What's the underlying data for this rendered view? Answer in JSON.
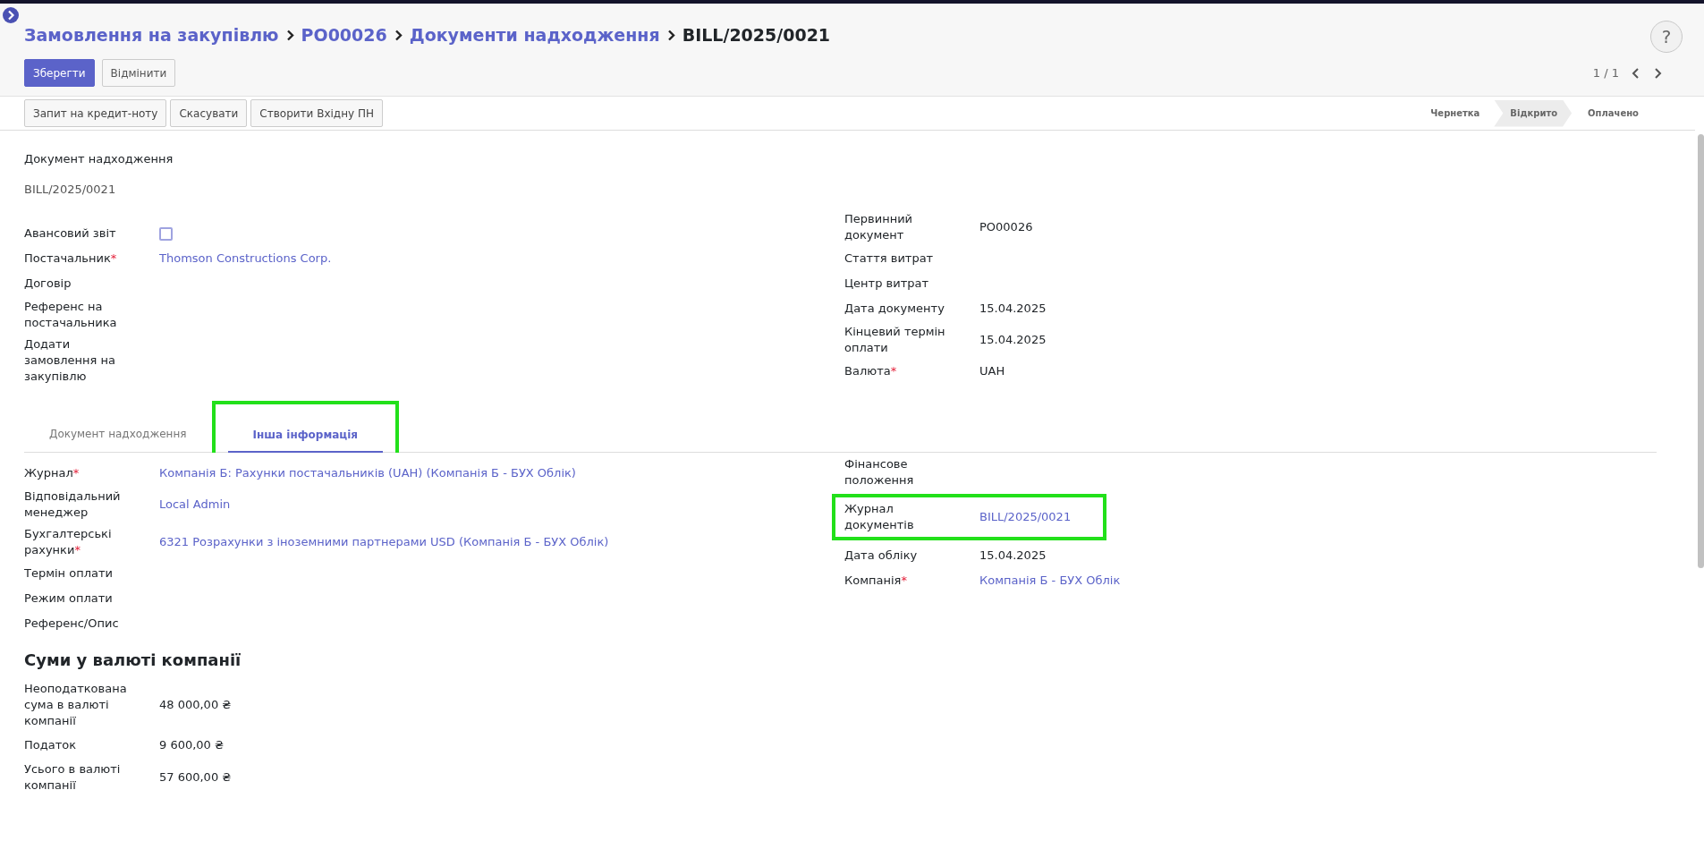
{
  "breadcrumb": [
    {
      "text": "Замовлення на закупівлю",
      "link": true
    },
    {
      "text": "PO00026",
      "link": true
    },
    {
      "text": "Документи надходження",
      "link": true
    },
    {
      "text": "BILL/2025/0021",
      "link": false
    }
  ],
  "buttons": [
    {
      "label": "Зберегти",
      "kind": "primary"
    },
    {
      "label": "Відмінити",
      "kind": "secondary"
    }
  ],
  "help_button": "?",
  "pager": "1 / 1",
  "actions": [
    "Запит на кредит-ноту",
    "Скасувати",
    "Створити Вхідну ПН"
  ],
  "stages": [
    {
      "label": "Чернетка",
      "selected": false
    },
    {
      "label": "Відкрито",
      "selected": true
    },
    {
      "label": "Оплачено",
      "selected": false
    }
  ],
  "document": {
    "title_label": "Документ надходження",
    "name": "BILL/2025/0021"
  },
  "main_left": [
    {
      "label": "Авансовий звіт",
      "kind": "checkbox",
      "checked": false
    },
    {
      "label": "Постачальник",
      "kind": "link",
      "value": "Thomson Constructions Corp.",
      "required_mark": "*"
    },
    {
      "label": "Договір",
      "kind": "empty"
    },
    {
      "label": "Референс на постачальника",
      "kind": "empty"
    },
    {
      "label": "Додати замовлення на закупівлю",
      "kind": "empty"
    }
  ],
  "main_right": [
    {
      "label": "Первинний документ",
      "kind": "text",
      "value": "PO00026"
    },
    {
      "label": "Стаття витрат",
      "kind": "empty"
    },
    {
      "label": "Центр витрат",
      "kind": "empty"
    },
    {
      "label": "Дата документу",
      "kind": "text",
      "value": "15.04.2025"
    },
    {
      "label": "Кінцевий термін оплати",
      "kind": "text",
      "value": "15.04.2025"
    },
    {
      "label": "Валюта",
      "kind": "text",
      "value": "UAH",
      "required_mark": "*"
    }
  ],
  "tabs": [
    {
      "label": "Документ надходження",
      "selected": false,
      "highlighted": false
    },
    {
      "label": "Інша інформація",
      "selected": true,
      "highlighted": true
    }
  ],
  "other_left": [
    {
      "label": "Журнал",
      "kind": "link",
      "value": "Компанія Б: Рахунки постачальників (UAH) (Компанія Б - БУХ Облік)",
      "required_mark": "*",
      "highlighted": false
    },
    {
      "label": "Відповідальний менеджер",
      "kind": "link",
      "value": "Local Admin",
      "highlighted": false
    },
    {
      "label": "Бухгалтерські рахунки",
      "kind": "link",
      "value": "6321 Розрахунки з іноземними партнерами USD (Компанія Б - БУХ Облік)",
      "required_mark": "*",
      "highlighted": false
    },
    {
      "label": "Термін оплати",
      "kind": "empty",
      "highlighted": false
    },
    {
      "label": "Режим оплати",
      "kind": "empty",
      "highlighted": false
    },
    {
      "label": "Референс/Опис",
      "kind": "empty",
      "highlighted": false
    }
  ],
  "other_right": [
    {
      "label": "Фінансове положення",
      "kind": "empty",
      "highlighted": false
    },
    {
      "label": "Журнал документів",
      "kind": "link",
      "value": "BILL/2025/0021",
      "highlighted": true
    },
    {
      "label": "Дата обліку",
      "kind": "text",
      "value": "15.04.2025",
      "highlighted": false
    },
    {
      "label": "Компанія",
      "kind": "link",
      "value": "Компанія Б - БУХ Облік",
      "required_mark": "*",
      "highlighted": false
    }
  ],
  "totals": {
    "title": "Суми у валюті компанії",
    "rows": [
      {
        "label": "Неоподаткована сума в валюті компанії",
        "value": "48 000,00 ₴"
      },
      {
        "label": "Податок",
        "value": "9 600,00 ₴"
      },
      {
        "label": "Усього в валюті компанії",
        "value": "57 600,00 ₴"
      }
    ]
  }
}
